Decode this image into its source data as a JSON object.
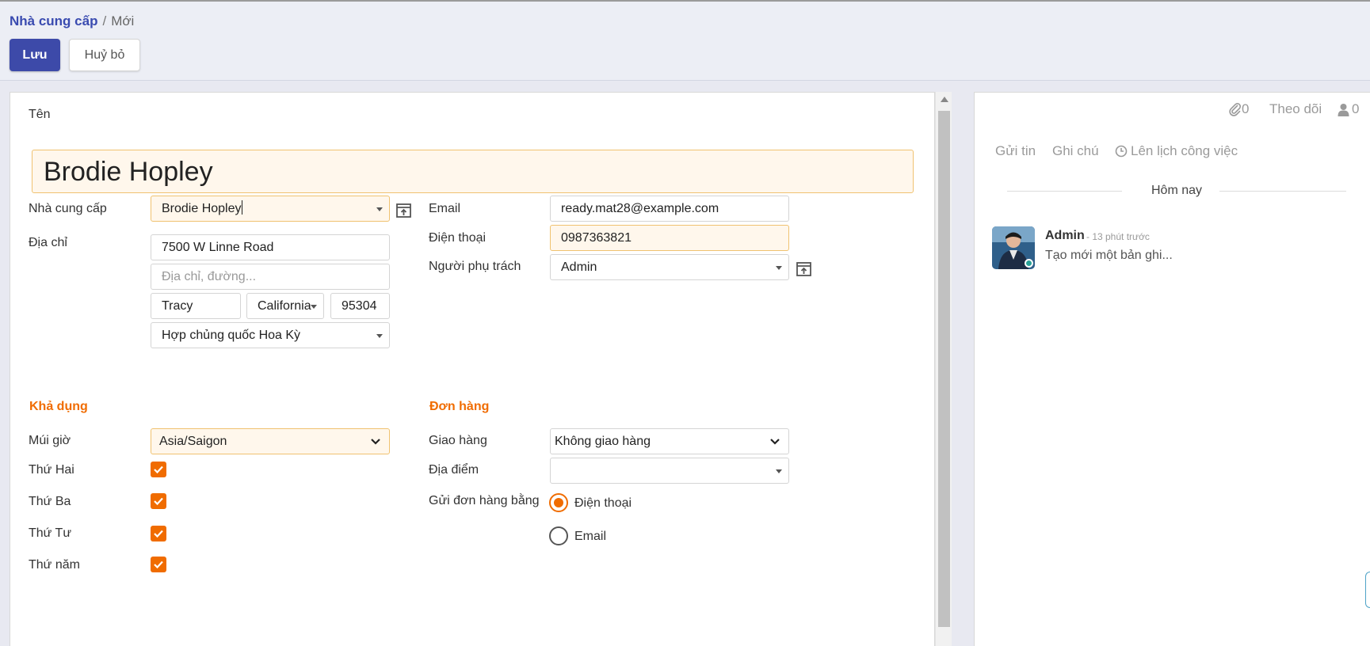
{
  "breadcrumb": {
    "parent": "Nhà cung cấp",
    "separator": "/",
    "current": "Mới"
  },
  "toolbar": {
    "save_label": "Lưu",
    "cancel_label": "Huỷ bỏ"
  },
  "form": {
    "name_label": "Tên",
    "name_value": "Brodie Hopley",
    "supplier_label": "Nhà cung cấp",
    "supplier_value": "Brodie Hopley",
    "address_label": "Địa chỉ",
    "street": "7500 W Linne Road",
    "street2_placeholder": "Địa chỉ, đường...",
    "city": "Tracy",
    "state": "California",
    "zip": "95304",
    "country": "Hợp chủng quốc Hoa Kỳ",
    "email_label": "Email",
    "email_value": "ready.mat28@example.com",
    "phone_label": "Điện thoại",
    "phone_value": "0987363821",
    "responsible_label": "Người phụ trách",
    "responsible_value": "Admin"
  },
  "availability": {
    "title": "Khả dụng",
    "timezone_label": "Múi giờ",
    "timezone_value": "Asia/Saigon",
    "days": [
      {
        "label": "Thứ Hai",
        "checked": true
      },
      {
        "label": "Thứ Ba",
        "checked": true
      },
      {
        "label": "Thứ Tư",
        "checked": true
      },
      {
        "label": "Thứ năm",
        "checked": true
      }
    ]
  },
  "orders": {
    "title": "Đơn hàng",
    "delivery_label": "Giao hàng",
    "delivery_value": "Không giao hàng",
    "location_label": "Địa điểm",
    "location_value": "",
    "send_via_label": "Gửi đơn hàng bằng",
    "send_options": [
      {
        "label": "Điện thoại",
        "selected": true
      },
      {
        "label": "Email",
        "selected": false
      }
    ]
  },
  "chatter": {
    "attachments_count": "0",
    "follow_label": "Theo dõi",
    "followers_count": "0",
    "send_message": "Gửi tin",
    "log_note": "Ghi chú",
    "schedule_activity": "Lên lịch công việc",
    "today_label": "Hôm nay",
    "message": {
      "author": "Admin",
      "time": "- 13 phút trước",
      "body": "Tạo mới một bản ghi..."
    }
  },
  "colors": {
    "primary": "#3d4aa9",
    "accent": "#f06c00",
    "required_bg": "#fff7ec",
    "online": "#28a197"
  }
}
